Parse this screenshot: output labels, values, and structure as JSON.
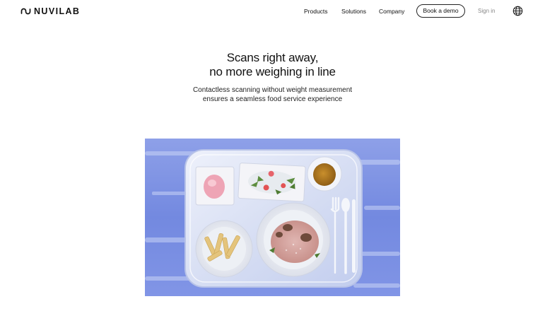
{
  "nav": {
    "brand": "NUVILAB",
    "links": [
      "Products",
      "Solutions",
      "Company"
    ],
    "demo_label": "Book a demo",
    "signin_label": "Sign in",
    "language_icon": "globe-icon"
  },
  "hero": {
    "title_lines": [
      "Scans right away,",
      "no more weighing in line"
    ],
    "subtitle_lines": [
      "Contactless scanning without weight measurement",
      "ensures a seamless food service experience"
    ]
  },
  "image": {
    "icon": "food-tray-illustration",
    "colors": {
      "background": "#7e94e6",
      "tray": "#dfe5f6",
      "soup": "#b07a22",
      "plate": "#f5f5f7"
    }
  }
}
